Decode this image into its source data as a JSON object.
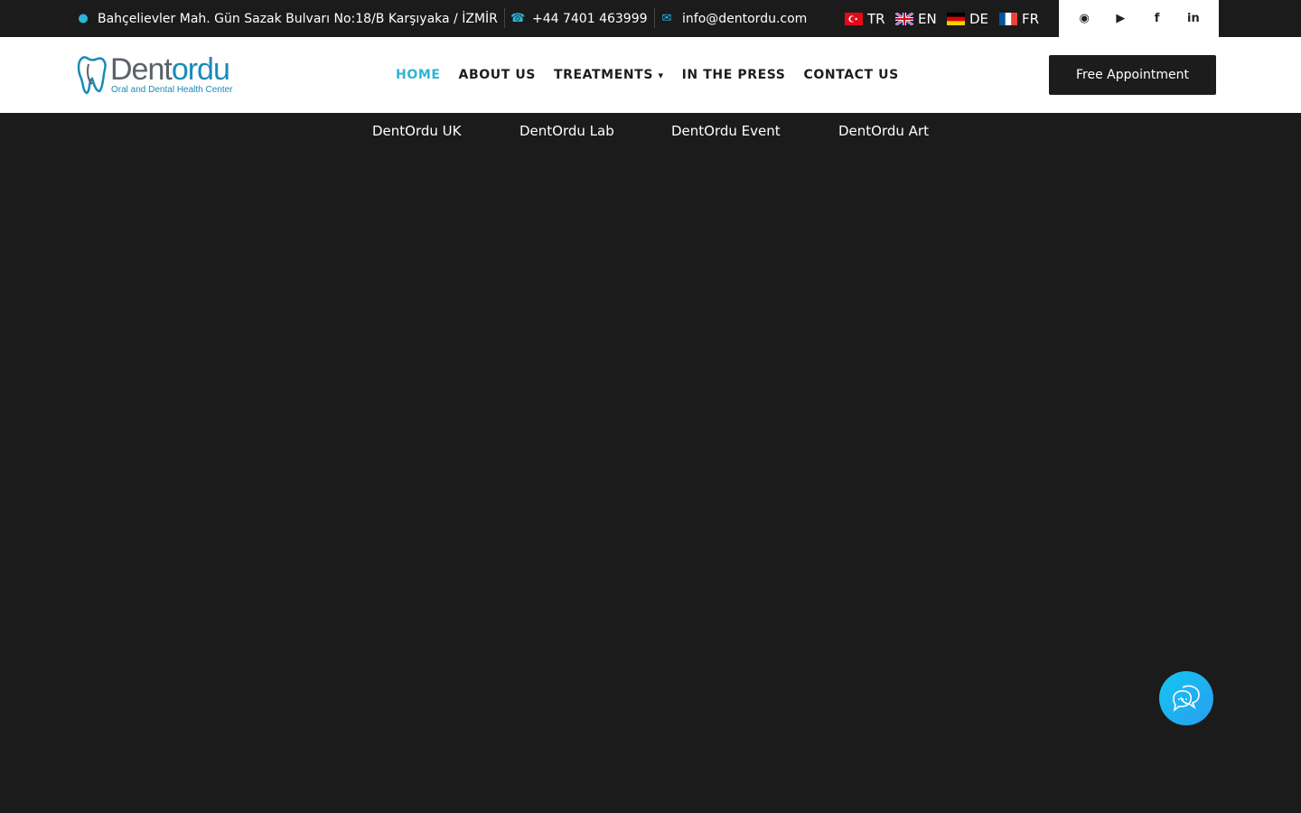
{
  "topbar": {
    "address": "Bahçelievler Mah. Gün Sazak Bulvarı No:18/B Karşıyaka / İZMİR",
    "phone": "+44 7401 463999",
    "email": "info@dentordu.com",
    "icons": {
      "address": "map-marker-icon",
      "phone": "phone-icon",
      "email": "envelope-icon"
    },
    "languages": [
      {
        "code": "TR",
        "flag": "turkey-flag-icon"
      },
      {
        "code": "EN",
        "flag": "uk-flag-icon"
      },
      {
        "code": "DE",
        "flag": "germany-flag-icon"
      },
      {
        "code": "FR",
        "flag": "france-flag-icon"
      }
    ],
    "social_icons": [
      "instagram-icon",
      "youtube-icon",
      "facebook-icon",
      "linkedin-icon"
    ]
  },
  "header": {
    "logo": {
      "name_part1": "Dent",
      "name_part2": "ordu",
      "tagline": "Oral and Dental Health Center"
    },
    "nav": [
      {
        "label": "HOME",
        "active": true
      },
      {
        "label": "ABOUT US",
        "active": false
      },
      {
        "label": "TREATMENTS",
        "active": false,
        "has_dropdown": true
      },
      {
        "label": "IN THE PRESS",
        "active": false
      },
      {
        "label": "CONTACT US",
        "active": false
      }
    ],
    "cta_label": "Free Appointment"
  },
  "subnav": [
    "DentOrdu UK",
    "DentOrdu Lab",
    "DentOrdu Event",
    "DentOrdu Art"
  ],
  "colors": {
    "accent": "#2fb4d8",
    "dark": "#1b1b1c",
    "chat_gradient": [
      "#12c7f0",
      "#2a9df0"
    ]
  },
  "chat": {
    "icon": "chat-bubbles-icon"
  }
}
